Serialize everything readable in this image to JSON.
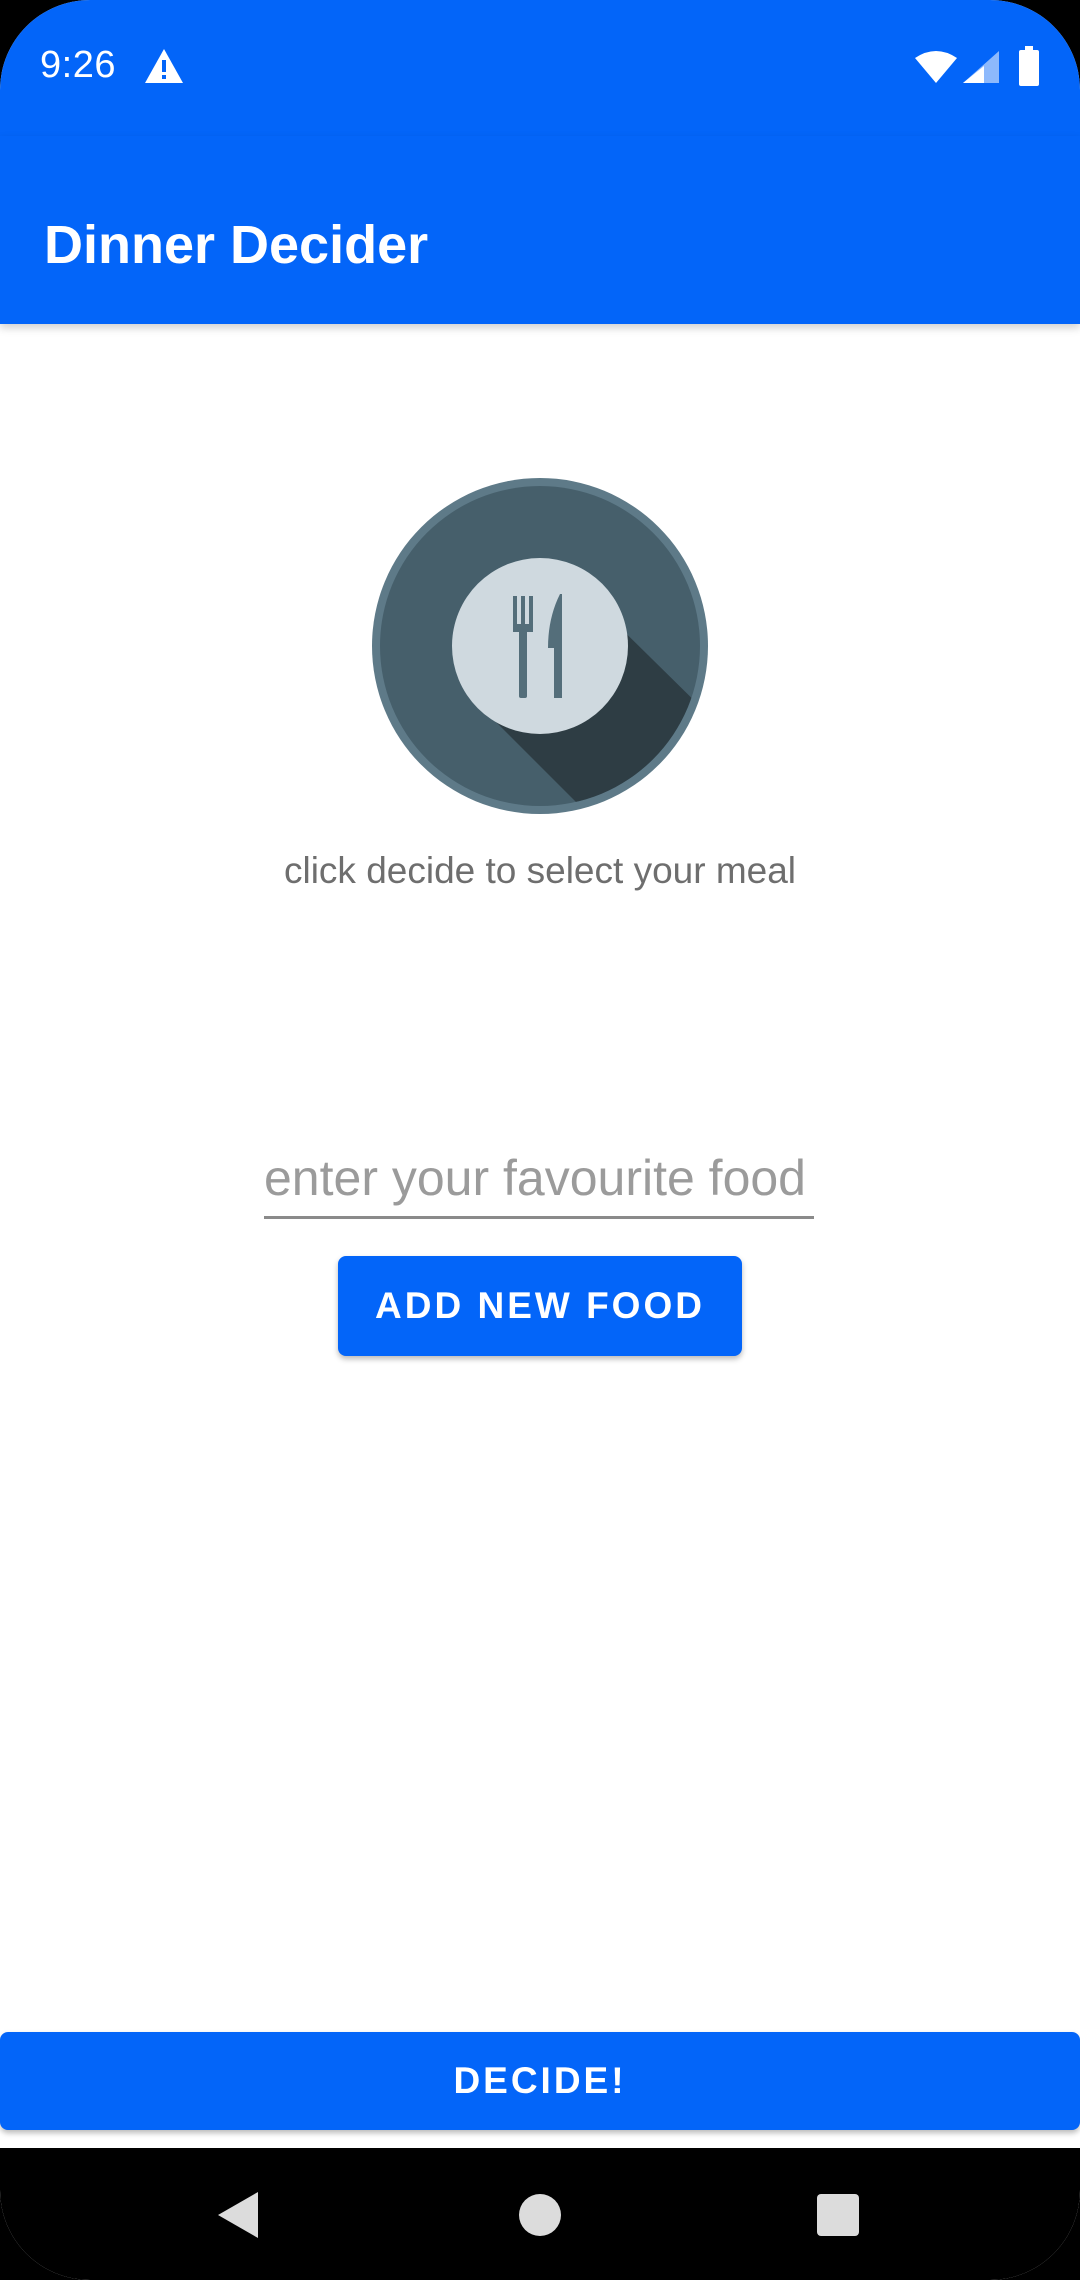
{
  "status_bar": {
    "time": "9:26",
    "icons": [
      "warning-icon",
      "wifi-icon",
      "cell-signal-icon",
      "battery-icon"
    ]
  },
  "app_bar": {
    "title": "Dinner Decider"
  },
  "main": {
    "logo_icon": "plate-fork-knife-icon",
    "subtitle": "click decide to select your meal",
    "food_input": {
      "value": "",
      "placeholder": "enter your favourite food"
    },
    "add_button_label": "ADD NEW FOOD",
    "decide_button_label": "DECIDE!"
  },
  "nav_bar": {
    "icons": [
      "back-icon",
      "home-icon",
      "recents-icon"
    ]
  },
  "colors": {
    "primary": "#0365f9",
    "plate_outer": "#465f6b",
    "plate_inner": "#cfd9df",
    "text_secondary": "#6e6e6e"
  }
}
